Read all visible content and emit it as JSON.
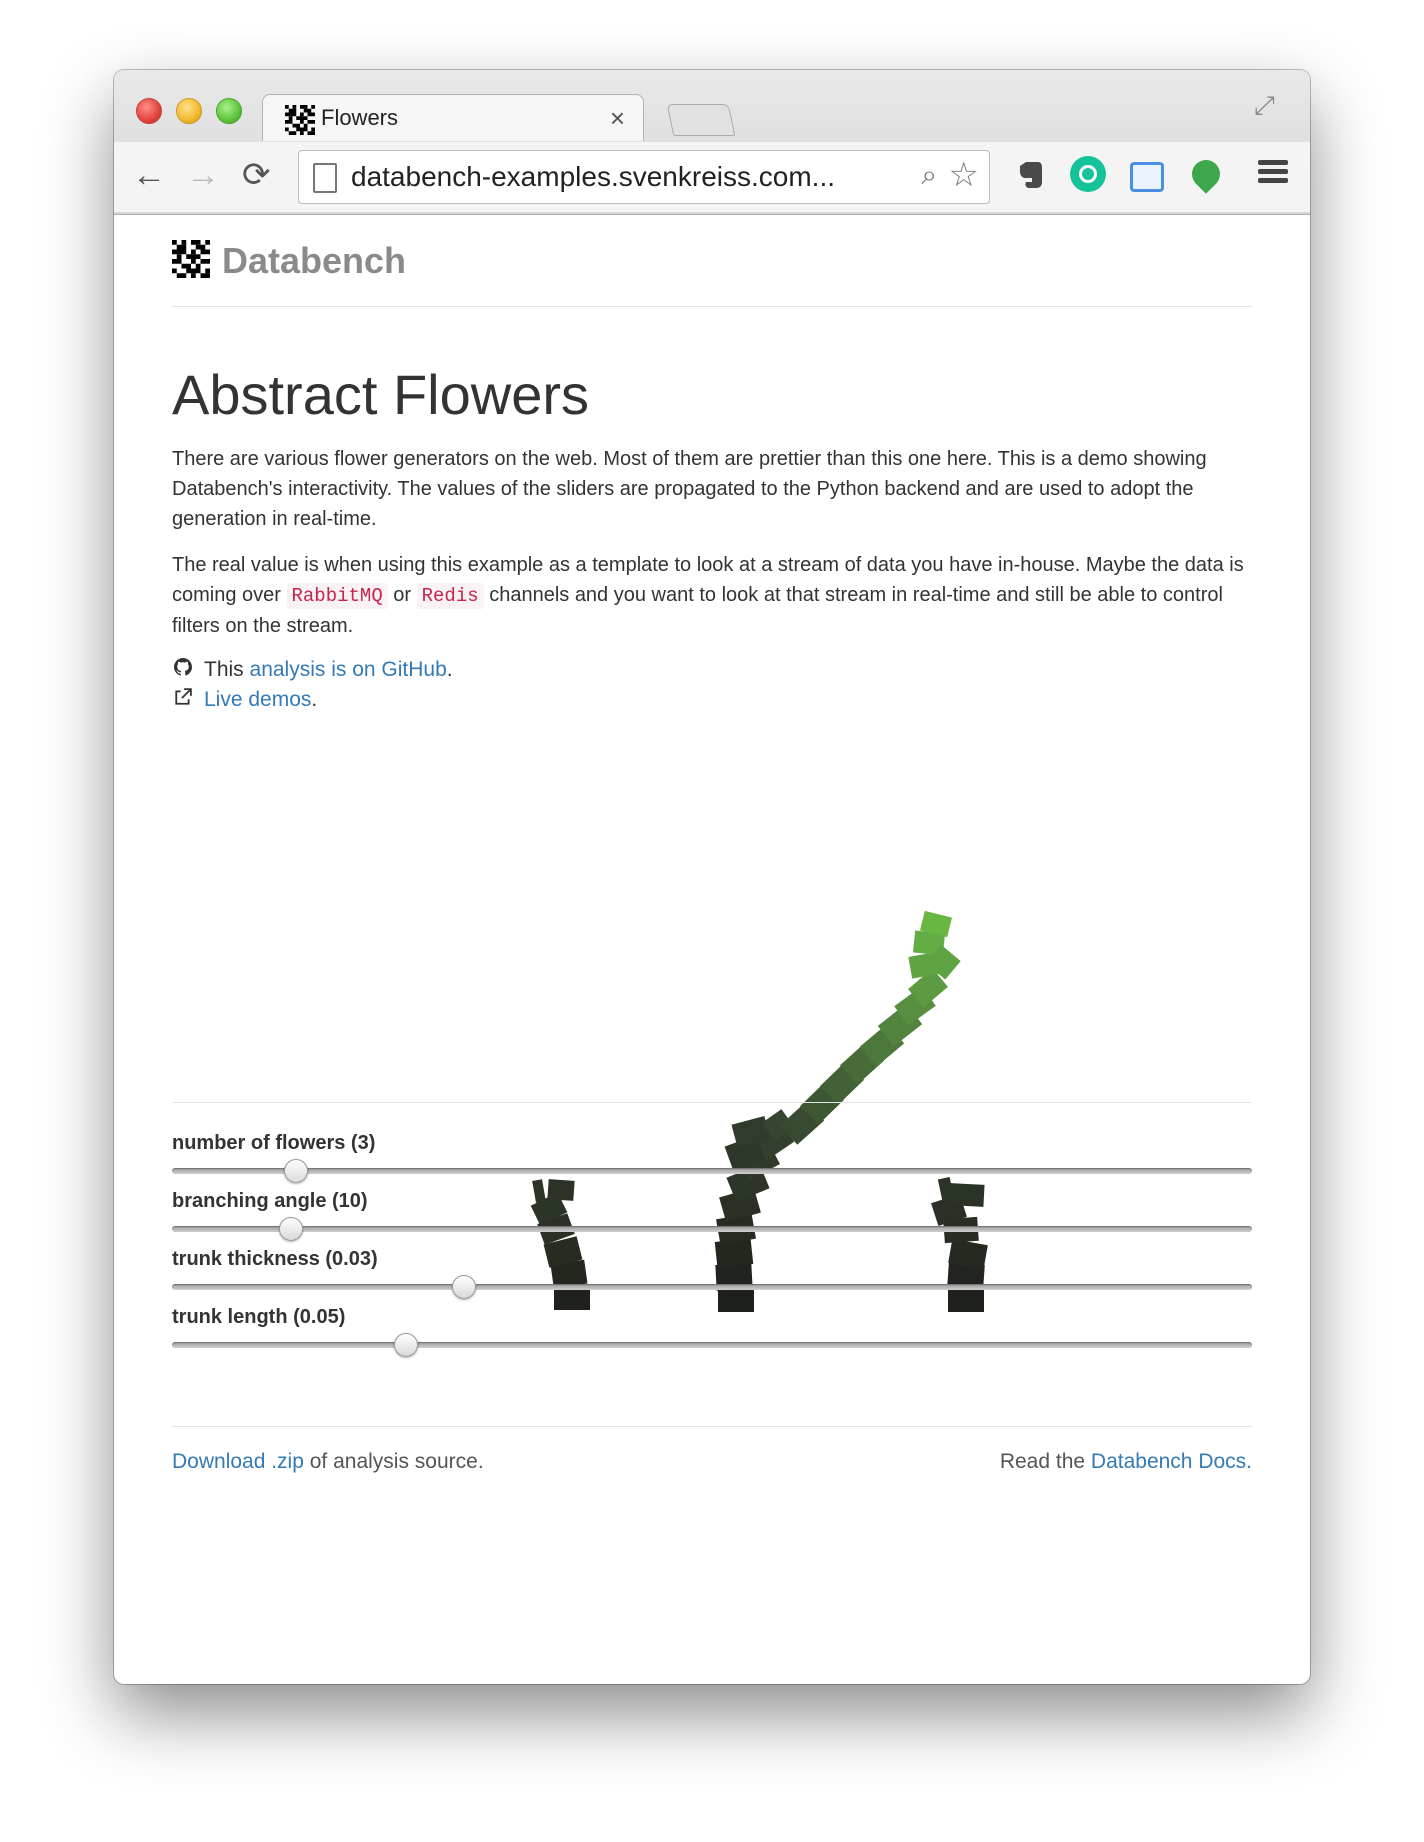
{
  "browser": {
    "tab_title": "Flowers",
    "tab_close": "×",
    "url": "databench-examples.svenkreiss.com...",
    "back_glyph": "←",
    "forward_glyph": "→",
    "reload_glyph": "⟳",
    "zoom_glyph": "⌕",
    "star_glyph": "☆",
    "fullscreen_glyph": "⤢",
    "extensions": [
      "evernote-icon",
      "grammarly-icon",
      "dashboard-icon",
      "leaf-icon"
    ]
  },
  "header": {
    "brand": "Databench"
  },
  "main": {
    "title": "Abstract Flowers",
    "intro": "There are various flower generators on the web. Most of them are prettier than this one here. This is a demo showing Databench's interactivity. The values of the sliders are propagated to the Python backend and are used to adopt the generation in real-time.",
    "para2_a": "The real value is when using this example as a template to look at a stream of data you have in-house. Maybe the data is coming over ",
    "code1": "RabbitMQ",
    "para2_b": " or ",
    "code2": "Redis",
    "para2_c": " channels and you want to look at that stream in real-time and still be able to control filters on the stream.",
    "github_prefix": "This ",
    "github_link": "analysis is on GitHub",
    "github_suffix": ".",
    "demos_link": "Live demos",
    "demos_suffix": "."
  },
  "sliders": [
    {
      "label": "number of flowers (3)",
      "fraction": 0.114
    },
    {
      "label": "branching angle (10)",
      "fraction": 0.109
    },
    {
      "label": "trunk thickness (0.03)",
      "fraction": 0.269
    },
    {
      "label": "trunk length (0.05)",
      "fraction": 0.216
    }
  ],
  "footer": {
    "download_link": "Download .zip",
    "download_suffix": " of analysis source.",
    "docs_prefix": "Read the ",
    "docs_link": "Databench Docs."
  },
  "colors": {
    "link": "#337ab7",
    "code": "#c7254e",
    "flower_dark": "#1f211d",
    "flower_light": "#6cbf40"
  }
}
